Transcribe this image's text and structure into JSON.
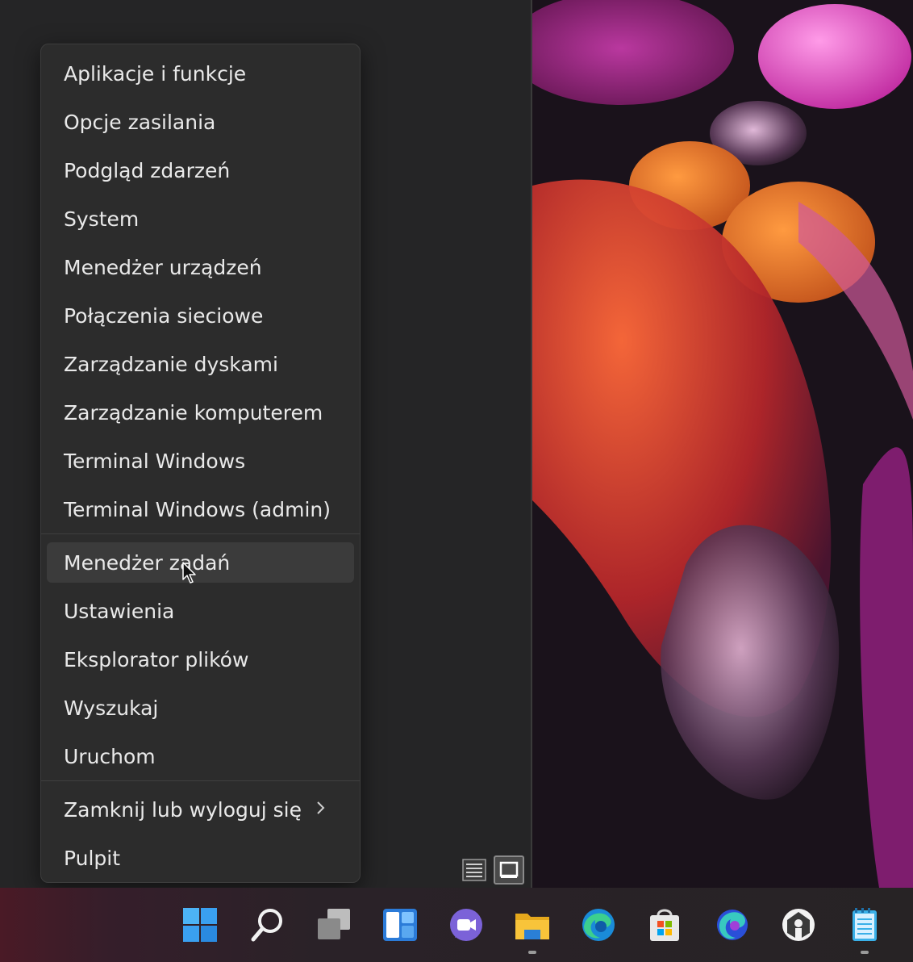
{
  "context_menu": {
    "items": [
      {
        "label": "Aplikacje i funkcje"
      },
      {
        "label": "Opcje zasilania"
      },
      {
        "label": "Podgląd zdarzeń"
      },
      {
        "label": "System"
      },
      {
        "label": "Menedżer urządzeń"
      },
      {
        "label": "Połączenia sieciowe"
      },
      {
        "label": "Zarządzanie dyskami"
      },
      {
        "label": "Zarządzanie komputerem"
      },
      {
        "label": "Terminal Windows"
      },
      {
        "label": "Terminal Windows (admin)"
      },
      {
        "label": "Menedżer zadań",
        "state": "hover"
      },
      {
        "label": "Ustawienia"
      },
      {
        "label": "Eksplorator plików"
      },
      {
        "label": "Wyszukaj"
      },
      {
        "label": "Uruchom"
      },
      {
        "label": "Zamknij lub wyloguj się",
        "submenu": "chevron-right-icon"
      },
      {
        "label": "Pulpit"
      }
    ]
  },
  "view_switcher": {
    "buttons": [
      {
        "icon": "list-view-icon",
        "selected": false
      },
      {
        "icon": "tile-view-icon",
        "selected": true
      }
    ]
  },
  "taskbar": {
    "icons": [
      {
        "name": "start-icon",
        "running": false
      },
      {
        "name": "search-icon",
        "running": false
      },
      {
        "name": "task-view-icon",
        "running": false
      },
      {
        "name": "widgets-icon",
        "running": false
      },
      {
        "name": "teams-chat-icon",
        "running": false
      },
      {
        "name": "file-explorer-icon",
        "running": true
      },
      {
        "name": "edge-icon",
        "running": false
      },
      {
        "name": "microsoft-store-icon",
        "running": false
      },
      {
        "name": "edge-dev-icon",
        "running": false
      },
      {
        "name": "app-icon",
        "running": false
      },
      {
        "name": "notepad-icon",
        "running": true
      }
    ]
  },
  "colors": {
    "menu_bg": "#2c2c2c",
    "hover_bg": "#3b3b3b",
    "text": "#e9e9e9",
    "accent_blue": "#3aa0f0"
  }
}
